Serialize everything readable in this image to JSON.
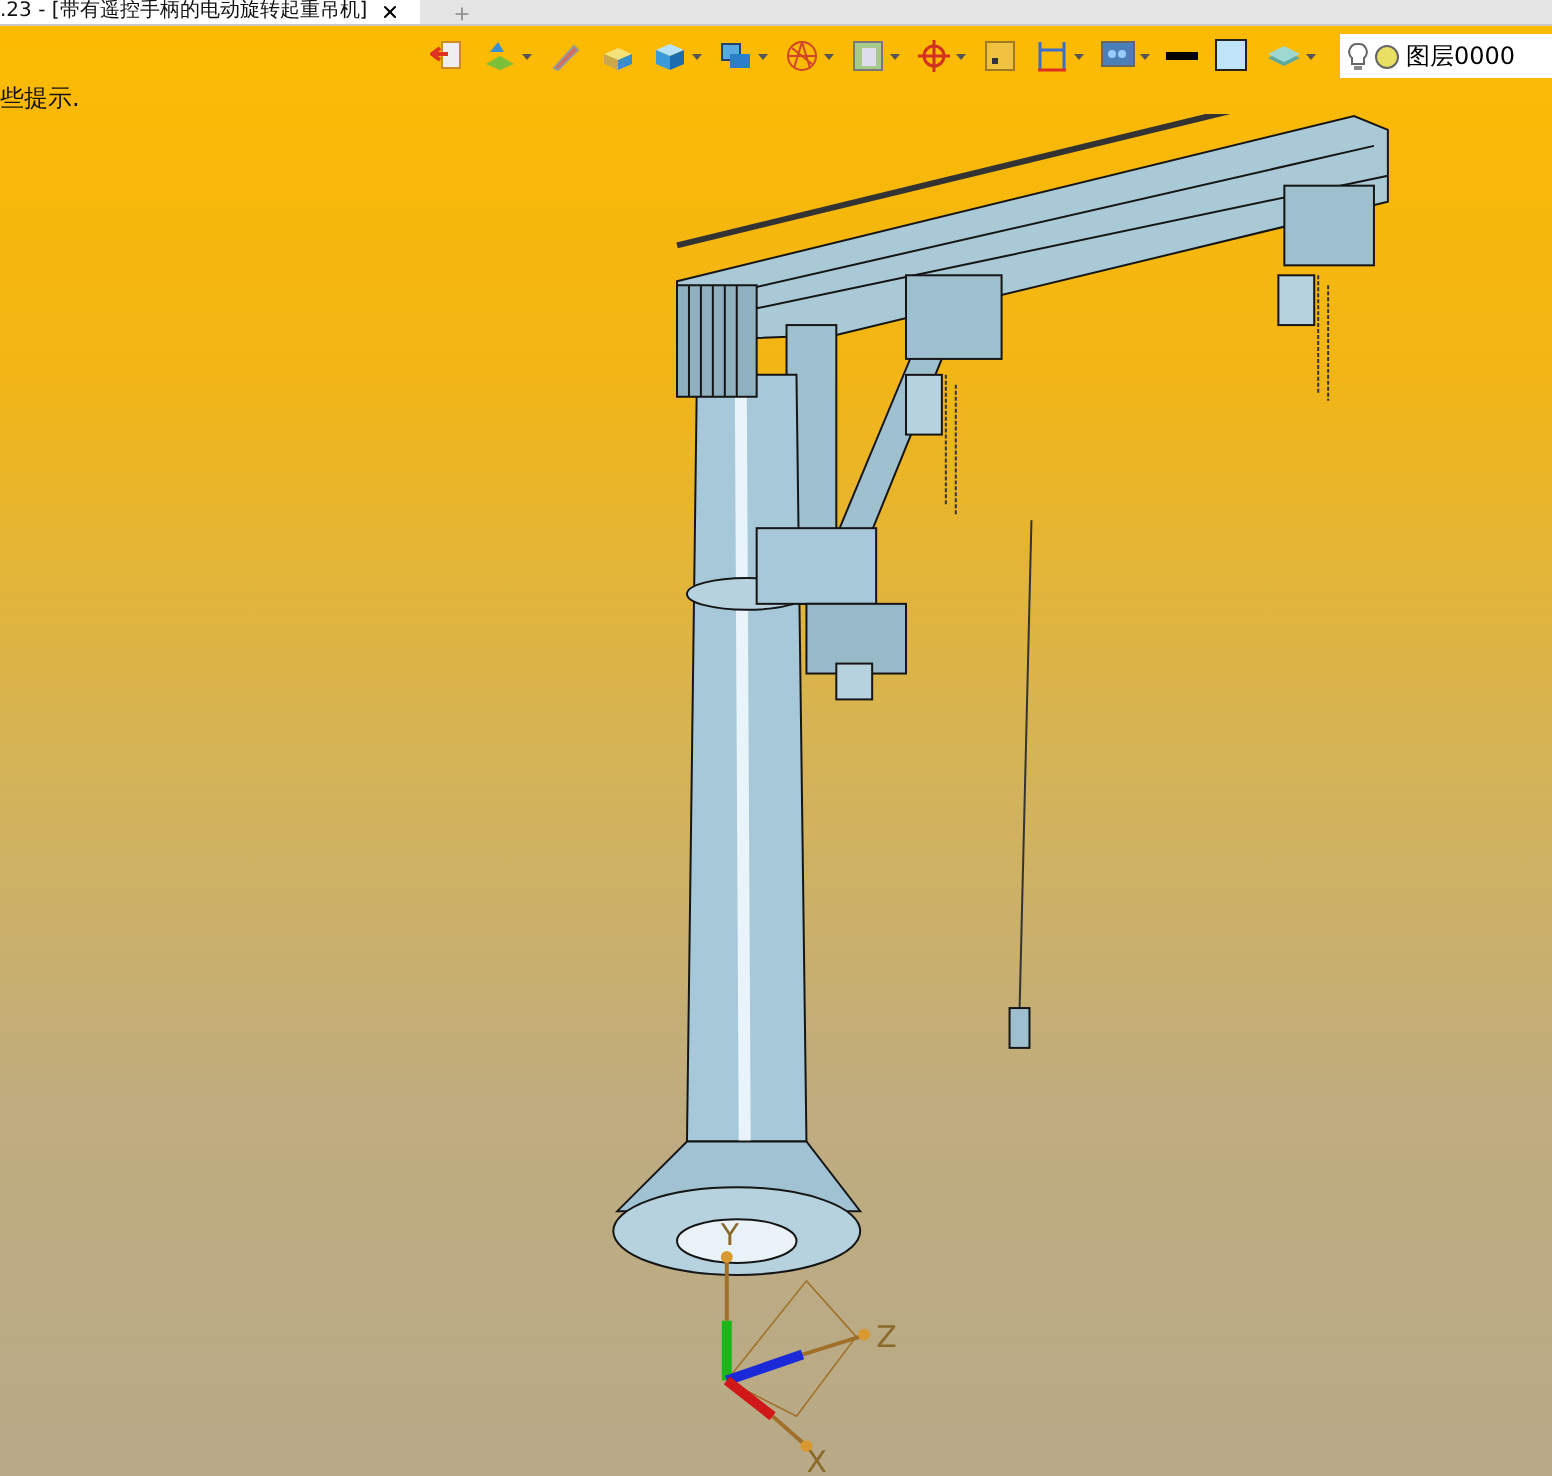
{
  "tabs": [
    {
      "label": ".23 - [带有遥控手柄的电动旋转起重吊机]",
      "selected": true
    }
  ],
  "toolbar": {
    "layer_field": {
      "value": "图层0000"
    }
  },
  "hint": "些提示.",
  "axes": [
    {
      "label": "Y",
      "kind": "y"
    },
    {
      "label": "Z",
      "kind": "z"
    },
    {
      "label": "X",
      "kind": "x"
    }
  ]
}
